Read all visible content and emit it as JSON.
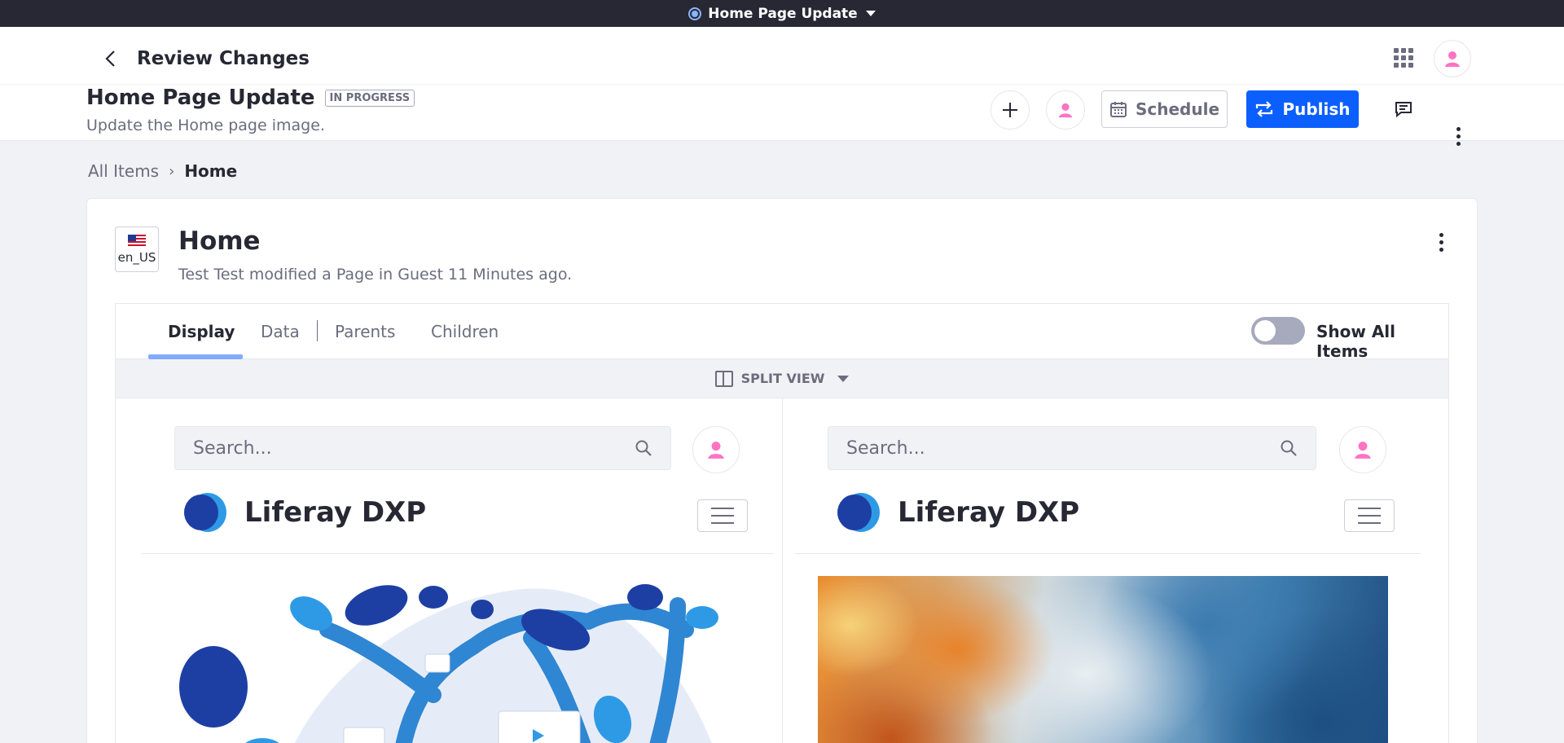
{
  "topbar": {
    "title": "Home Page Update"
  },
  "header": {
    "back_label": "Review Changes",
    "publication_title": "Home Page Update",
    "status_badge": "IN PROGRESS",
    "description": "Update the Home page image.",
    "schedule_label": "Schedule",
    "publish_label": "Publish"
  },
  "breadcrumb": {
    "items": [
      "All Items",
      "Home"
    ]
  },
  "item": {
    "locale": "en_US",
    "title": "Home",
    "subtitle": "Test Test modified a Page in Guest 11 Minutes ago."
  },
  "tabs": [
    {
      "label": "Display",
      "active": true
    },
    {
      "label": "Data",
      "active": false
    },
    {
      "label": "Parents",
      "active": false
    },
    {
      "label": "Children",
      "active": false
    }
  ],
  "toggle": {
    "label": "Show All Items",
    "on": false
  },
  "split_view": {
    "label": "SPLIT VIEW"
  },
  "preview": {
    "left": {
      "search_placeholder": "Search...",
      "site_name": "Liferay DXP"
    },
    "right": {
      "search_placeholder": "Search...",
      "site_name": "Liferay DXP"
    }
  },
  "colors": {
    "accent": "#0b5fff",
    "tab_underline": "#80acff",
    "avatar_icon": "#ff73c3"
  }
}
